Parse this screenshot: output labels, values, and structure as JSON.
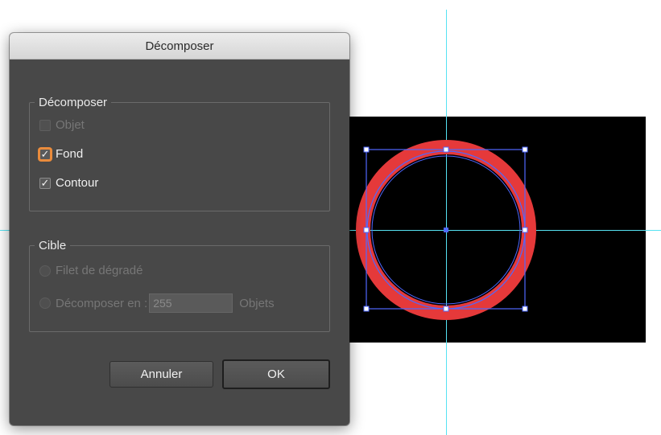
{
  "dialog": {
    "title": "Décomposer",
    "decompose_group": {
      "legend": "Décomposer",
      "options": [
        {
          "label": "Objet",
          "checked": false,
          "enabled": false
        },
        {
          "label": "Fond",
          "checked": true,
          "enabled": true,
          "focused": true
        },
        {
          "label": "Contour",
          "checked": true,
          "enabled": true
        }
      ]
    },
    "target_group": {
      "legend": "Cible",
      "gradient_mesh_label": "Filet de dégradé",
      "expand_to_label": "Décomposer en :",
      "count_value": "255",
      "count_unit": "Objets"
    },
    "cancel_label": "Annuler",
    "ok_label": "OK"
  },
  "colors": {
    "dialog_bg": "#484848",
    "artboard": "#000000",
    "circle_stroke": "#e5393a",
    "selection": "#4f68ff",
    "guides": "#56e3f2",
    "focus_ring": "#e98b3c"
  },
  "icons": [
    "checkmark-icon",
    "radio-icon"
  ]
}
